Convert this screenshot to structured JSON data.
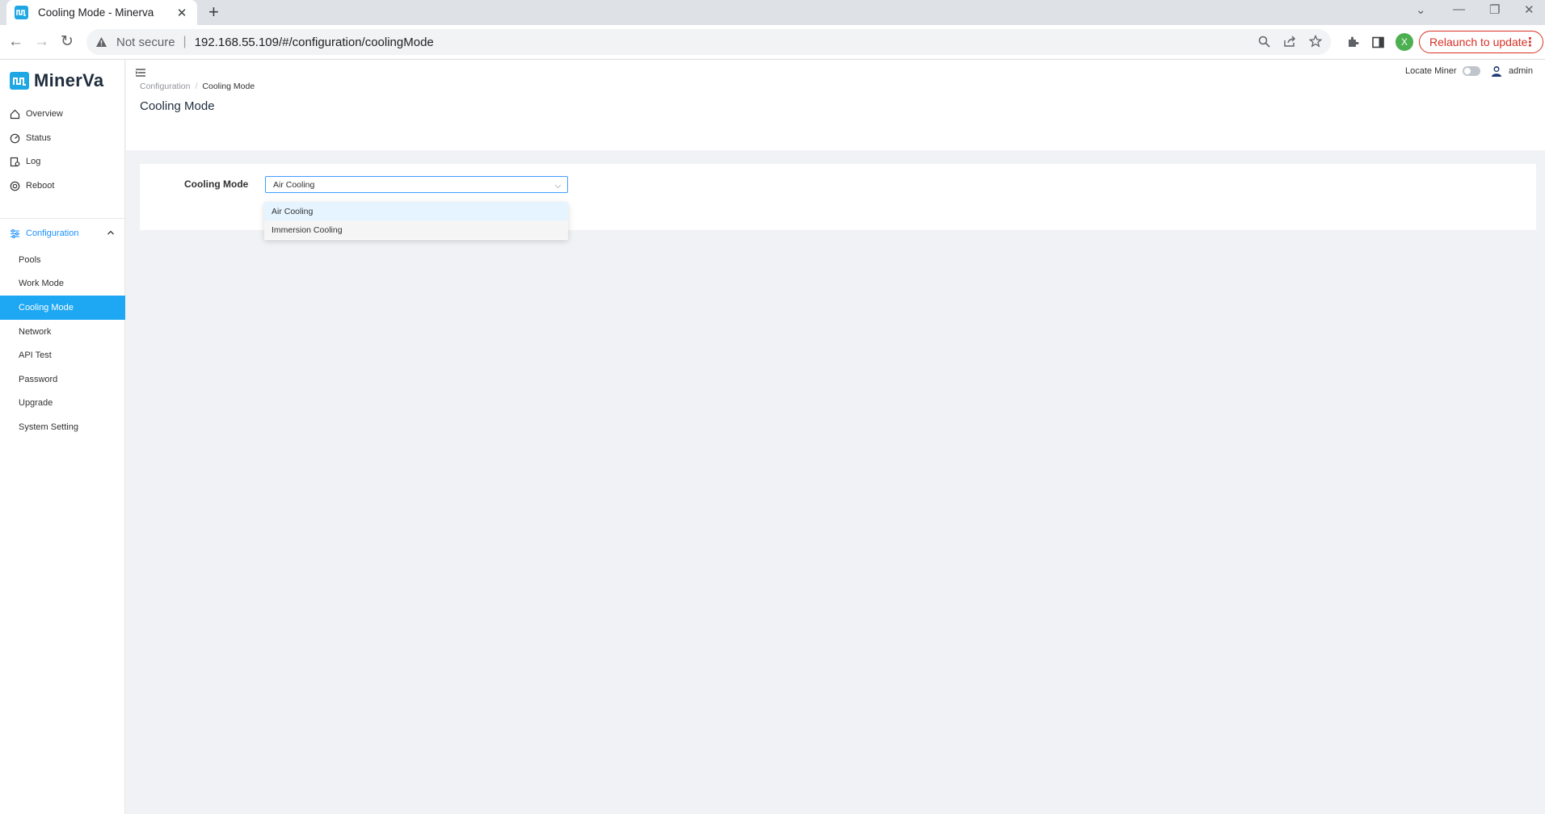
{
  "browser": {
    "tab_title": "Cooling Mode - Minerva",
    "security_label": "Not secure",
    "url": "192.168.55.109/#/configuration/coolingMode",
    "profile_initial": "X",
    "relaunch_label": "Relaunch to update"
  },
  "app": {
    "logo_text": "MinerVa",
    "brand_color": "#1ea7e4",
    "accent_color": "#1ea7f3"
  },
  "sidebar": {
    "items": [
      {
        "label": "Overview",
        "icon": "home-icon"
      },
      {
        "label": "Status",
        "icon": "dashboard-icon"
      },
      {
        "label": "Log",
        "icon": "log-icon"
      },
      {
        "label": "Reboot",
        "icon": "reboot-icon"
      }
    ],
    "config": {
      "label": "Configuration",
      "icon": "sliders-icon",
      "expanded": true
    },
    "sub_items": [
      "Pools",
      "Work Mode",
      "Cooling Mode",
      "Network",
      "API Test",
      "Password",
      "Upgrade",
      "System Setting"
    ],
    "active_item": "Cooling Mode"
  },
  "header": {
    "locate_label": "Locate Miner",
    "locate_on": false,
    "user_name": "admin"
  },
  "breadcrumb": {
    "parent": "Configuration",
    "current": "Cooling Mode"
  },
  "page": {
    "title": "Cooling Mode",
    "form_label": "Cooling Mode",
    "select_value": "Air Cooling",
    "options": [
      "Air Cooling",
      "Immersion Cooling"
    ]
  }
}
